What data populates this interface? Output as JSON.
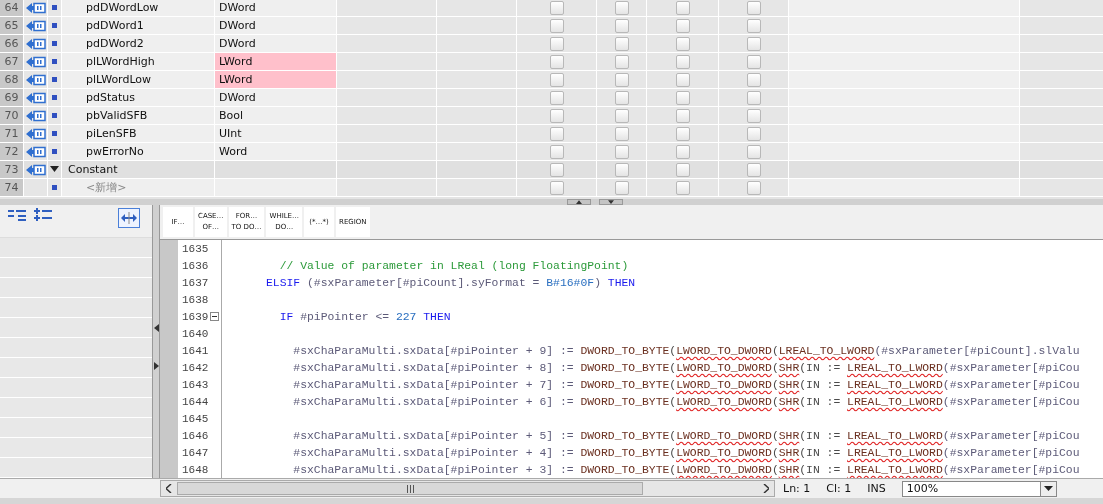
{
  "interface_table": {
    "rows": [
      {
        "number": "64",
        "kind": "member",
        "name": "pdDWordLow",
        "type": "DWord",
        "highlighted": false,
        "checks": [
          false,
          false,
          false,
          false
        ]
      },
      {
        "number": "65",
        "kind": "member",
        "name": "pdDWord1",
        "type": "DWord",
        "highlighted": false,
        "checks": [
          false,
          false,
          false,
          false
        ]
      },
      {
        "number": "66",
        "kind": "member",
        "name": "pdDWord2",
        "type": "DWord",
        "highlighted": false,
        "checks": [
          false,
          false,
          false,
          false
        ]
      },
      {
        "number": "67",
        "kind": "member",
        "name": "plLWordHigh",
        "type": "LWord",
        "highlighted": true,
        "checks": [
          false,
          false,
          false,
          false
        ]
      },
      {
        "number": "68",
        "kind": "member",
        "name": "plLWordLow",
        "type": "LWord",
        "highlighted": true,
        "checks": [
          false,
          false,
          false,
          false
        ]
      },
      {
        "number": "69",
        "kind": "member",
        "name": "pdStatus",
        "type": "DWord",
        "highlighted": false,
        "checks": [
          false,
          false,
          false,
          false
        ]
      },
      {
        "number": "70",
        "kind": "member",
        "name": "pbValidSFB",
        "type": "Bool",
        "highlighted": false,
        "checks": [
          false,
          false,
          false,
          false
        ]
      },
      {
        "number": "71",
        "kind": "member",
        "name": "piLenSFB",
        "type": "UInt",
        "highlighted": false,
        "checks": [
          false,
          false,
          false,
          false
        ]
      },
      {
        "number": "72",
        "kind": "member",
        "name": "pwErrorNo",
        "type": "Word",
        "highlighted": false,
        "checks": [
          false,
          false,
          false,
          false
        ]
      },
      {
        "number": "73",
        "kind": "section",
        "name": "Constant",
        "expanded": true,
        "highlighted": false,
        "checks": [
          false,
          false,
          false,
          false
        ]
      },
      {
        "number": "74",
        "kind": "new",
        "name": "<新增>",
        "highlighted": false,
        "checks": [
          false,
          false,
          false,
          false
        ]
      }
    ]
  },
  "toolbar": {
    "buttons": [
      "IF…",
      "CASE…\nOF…",
      "FOR…\nTO DO…",
      "WHILE…\nDO…",
      "(*…*)",
      "REGION"
    ]
  },
  "code": {
    "lines": [
      {
        "number": "1635"
      },
      {
        "number": "1636",
        "segments": [
          {
            "text": "        // Value of parameter in LReal (long FloatingPoint)",
            "kind": "comment"
          }
        ]
      },
      {
        "number": "1637",
        "segments": [
          {
            "text": "      ELSIF",
            "kind": "keyword"
          },
          {
            "text": " (#sxParameter[#piCount].syFormat = ",
            "kind": "var"
          },
          {
            "text": "B#16#0F",
            "kind": "number"
          },
          {
            "text": ") ",
            "kind": "var"
          },
          {
            "text": "THEN",
            "kind": "keyword"
          }
        ]
      },
      {
        "number": "1638"
      },
      {
        "number": "1639",
        "expanded": true,
        "segments": [
          {
            "text": "        IF",
            "kind": "keyword"
          },
          {
            "text": " #piPointer <= ",
            "kind": "var"
          },
          {
            "text": "227",
            "kind": "number"
          },
          {
            "text": " THEN",
            "kind": "keyword"
          }
        ]
      },
      {
        "number": "1640"
      },
      {
        "number": "1641",
        "segments": [
          {
            "text": "          #sxChaParaMulti.sxData[#piPointer + 9] := ",
            "kind": "var"
          },
          {
            "text": "DWORD_TO_BYTE",
            "kind": "func"
          },
          {
            "text": "(",
            "kind": "text"
          },
          {
            "text": "LWORD_TO_DWORD",
            "kind": "error"
          },
          {
            "text": "(",
            "kind": "text"
          },
          {
            "text": "LREAL_TO_LWORD",
            "kind": "error"
          },
          {
            "text": "(#sxParameter[#piCount].slValu",
            "kind": "var"
          }
        ]
      },
      {
        "number": "1642",
        "segments": [
          {
            "text": "          #sxChaParaMulti.sxData[#piPointer + 8] := ",
            "kind": "var"
          },
          {
            "text": "DWORD_TO_BYTE",
            "kind": "func"
          },
          {
            "text": "(",
            "kind": "text"
          },
          {
            "text": "LWORD_TO_DWORD",
            "kind": "error"
          },
          {
            "text": "(",
            "kind": "text"
          },
          {
            "text": "SHR",
            "kind": "error"
          },
          {
            "text": "(IN := ",
            "kind": "text"
          },
          {
            "text": "LREAL_TO_LWORD",
            "kind": "error"
          },
          {
            "text": "(#sxParameter[#piCou",
            "kind": "var"
          }
        ]
      },
      {
        "number": "1643",
        "segments": [
          {
            "text": "          #sxChaParaMulti.sxData[#piPointer + 7] := ",
            "kind": "var"
          },
          {
            "text": "DWORD_TO_BYTE",
            "kind": "func"
          },
          {
            "text": "(",
            "kind": "text"
          },
          {
            "text": "LWORD_TO_DWORD",
            "kind": "error"
          },
          {
            "text": "(",
            "kind": "text"
          },
          {
            "text": "SHR",
            "kind": "error"
          },
          {
            "text": "(IN := ",
            "kind": "text"
          },
          {
            "text": "LREAL_TO_LWORD",
            "kind": "error"
          },
          {
            "text": "(#sxParameter[#piCou",
            "kind": "var"
          }
        ]
      },
      {
        "number": "1644",
        "segments": [
          {
            "text": "          #sxChaParaMulti.sxData[#piPointer + 6] := ",
            "kind": "var"
          },
          {
            "text": "DWORD_TO_BYTE",
            "kind": "func"
          },
          {
            "text": "(",
            "kind": "text"
          },
          {
            "text": "LWORD_TO_DWORD",
            "kind": "error"
          },
          {
            "text": "(",
            "kind": "text"
          },
          {
            "text": "SHR",
            "kind": "error"
          },
          {
            "text": "(IN := ",
            "kind": "text"
          },
          {
            "text": "LREAL_TO_LWORD",
            "kind": "error"
          },
          {
            "text": "(#sxParameter[#piCou",
            "kind": "var"
          }
        ]
      },
      {
        "number": "1645"
      },
      {
        "number": "1646",
        "segments": [
          {
            "text": "          #sxChaParaMulti.sxData[#piPointer + 5] := ",
            "kind": "var"
          },
          {
            "text": "DWORD_TO_BYTE",
            "kind": "func"
          },
          {
            "text": "(",
            "kind": "text"
          },
          {
            "text": "LWORD_TO_DWORD",
            "kind": "error"
          },
          {
            "text": "(",
            "kind": "text"
          },
          {
            "text": "SHR",
            "kind": "error"
          },
          {
            "text": "(IN := ",
            "kind": "text"
          },
          {
            "text": "LREAL_TO_LWORD",
            "kind": "error"
          },
          {
            "text": "(#sxParameter[#piCou",
            "kind": "var"
          }
        ]
      },
      {
        "number": "1647",
        "segments": [
          {
            "text": "          #sxChaParaMulti.sxData[#piPointer + 4] := ",
            "kind": "var"
          },
          {
            "text": "DWORD_TO_BYTE",
            "kind": "func"
          },
          {
            "text": "(",
            "kind": "text"
          },
          {
            "text": "LWORD_TO_DWORD",
            "kind": "error"
          },
          {
            "text": "(",
            "kind": "text"
          },
          {
            "text": "SHR",
            "kind": "error"
          },
          {
            "text": "(IN := ",
            "kind": "text"
          },
          {
            "text": "LREAL_TO_LWORD",
            "kind": "error"
          },
          {
            "text": "(#sxParameter[#piCou",
            "kind": "var"
          }
        ]
      },
      {
        "number": "1648",
        "segments": [
          {
            "text": "          #sxChaParaMulti.sxData[#piPointer + 3] := ",
            "kind": "var"
          },
          {
            "text": "DWORD_TO_BYTE",
            "kind": "func"
          },
          {
            "text": "(",
            "kind": "text"
          },
          {
            "text": "LWORD_TO_DWORD",
            "kind": "error"
          },
          {
            "text": "(",
            "kind": "text"
          },
          {
            "text": "SHR",
            "kind": "error"
          },
          {
            "text": "(IN := ",
            "kind": "text"
          },
          {
            "text": "LREAL_TO_LWORD",
            "kind": "error"
          },
          {
            "text": "(#sxParameter[#piCou",
            "kind": "var"
          }
        ]
      }
    ]
  },
  "status_bar": {
    "line": "Ln: 1",
    "column": "Cl: 1",
    "mode": "INS",
    "zoom": "100%"
  }
}
